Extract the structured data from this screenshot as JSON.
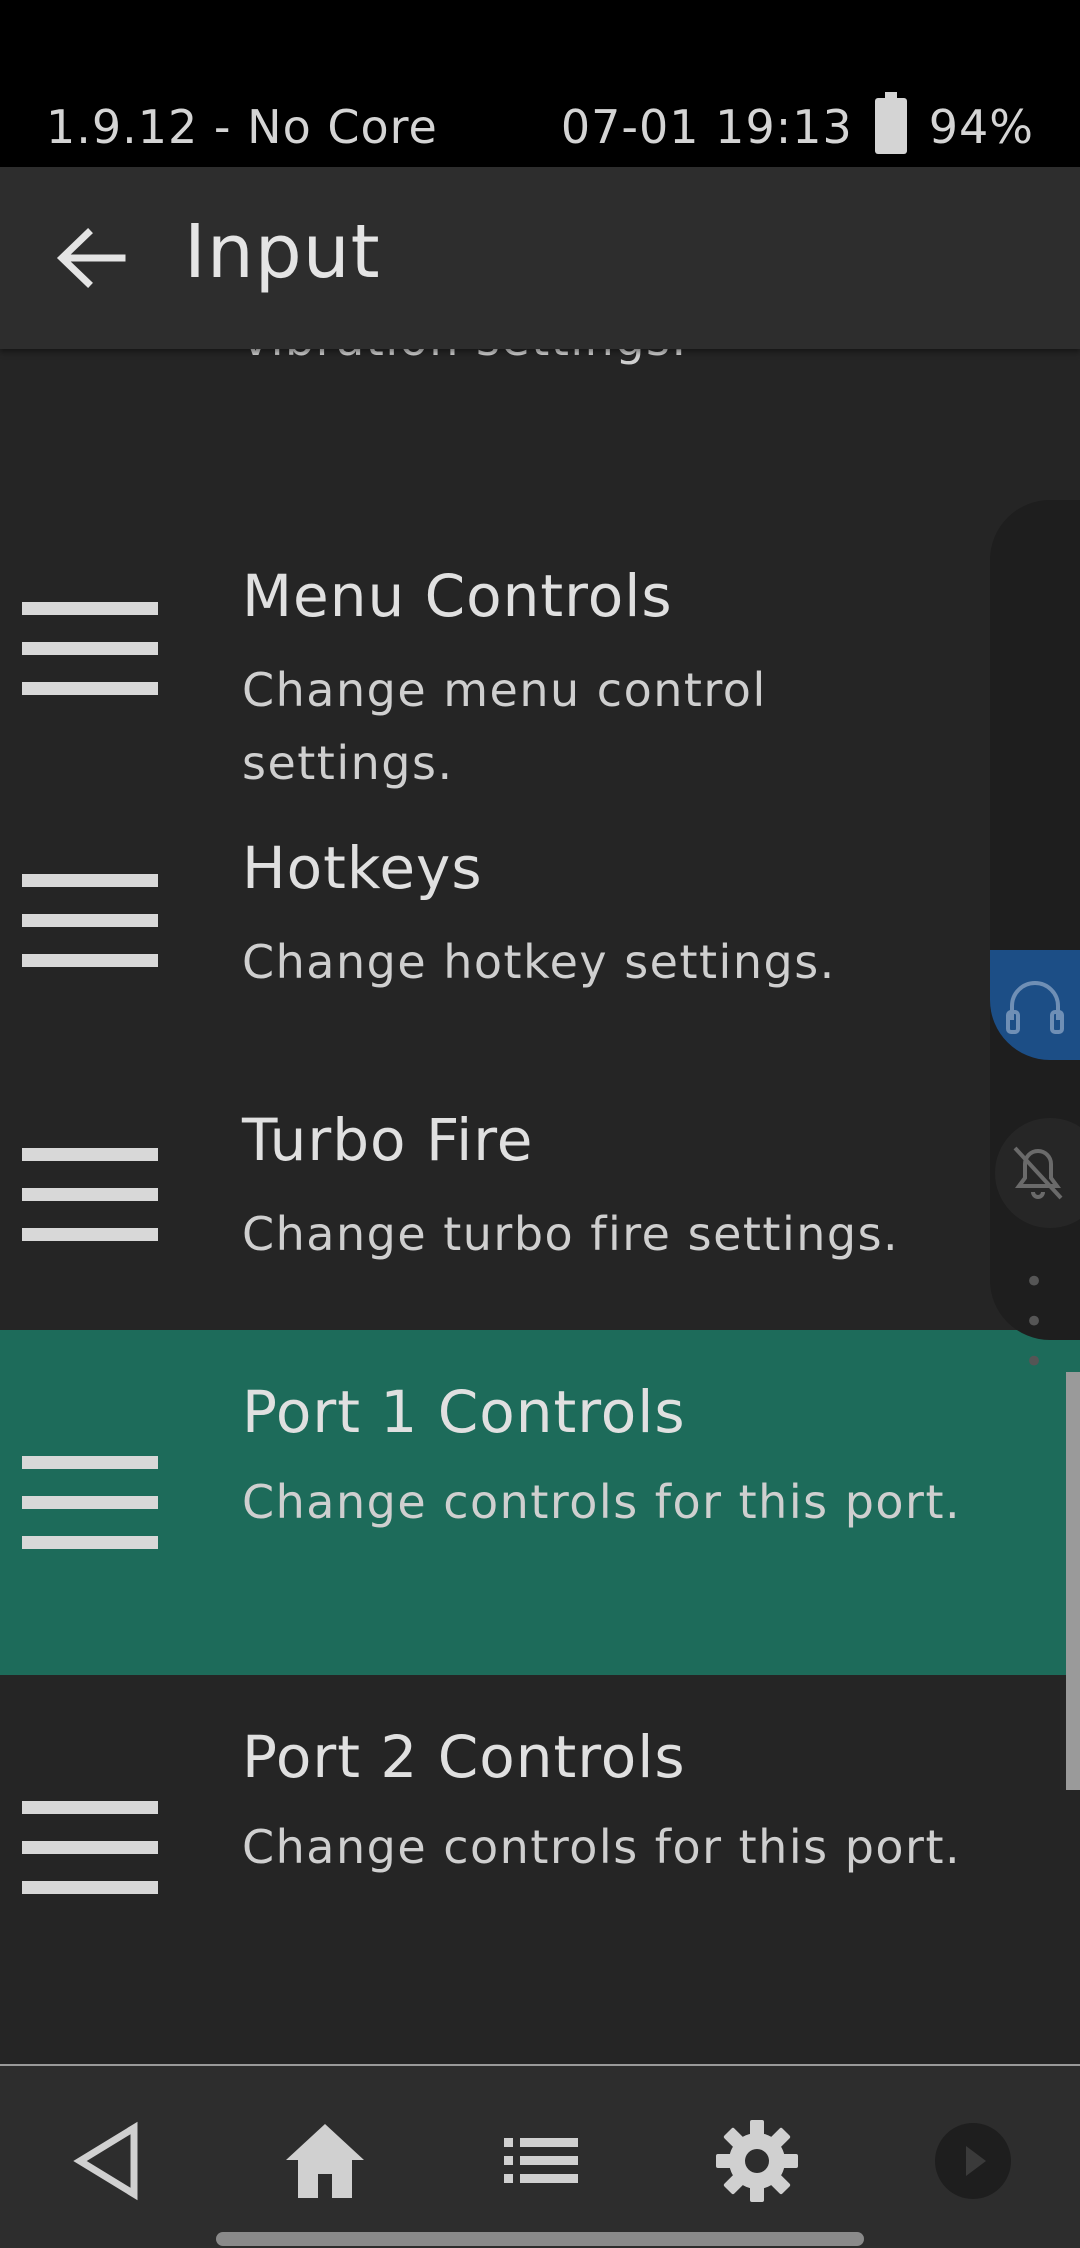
{
  "status_bar": {
    "left_text": "1.9.12 - No Core",
    "time": "07-01 19:13",
    "battery_icon": "battery-icon",
    "battery": "94%"
  },
  "header": {
    "back_icon": "arrow-left-icon",
    "title": "Input"
  },
  "items": [
    {
      "icon": "menu-lines-icon",
      "title": "",
      "subtitle": "Change haptic feedback and vibration settings."
    },
    {
      "icon": "menu-lines-icon",
      "title": "Menu Controls",
      "subtitle": "Change menu control settings."
    },
    {
      "icon": "menu-lines-icon",
      "title": "Hotkeys",
      "subtitle": "Change hotkey settings."
    },
    {
      "icon": "menu-lines-icon",
      "title": "Turbo Fire",
      "subtitle": "Change turbo fire settings."
    },
    {
      "icon": "menu-lines-icon",
      "title": "Port 1 Controls",
      "subtitle": "Change controls for this port.",
      "selected": true
    },
    {
      "icon": "menu-lines-icon",
      "title": "Port 2 Controls",
      "subtitle": "Change controls for this port."
    }
  ],
  "floating_panel": {
    "icons": [
      "headset-icon",
      "bell-off-icon",
      "more-dots-icon"
    ],
    "more_label": "• • •"
  },
  "nav_bar": {
    "buttons": [
      "back-triangle-icon",
      "home-icon",
      "list-icon",
      "settings-gear-icon",
      "play-icon"
    ]
  },
  "colors": {
    "background": "#252525",
    "header": "#2d2d2d",
    "selected": "#1d6b5a",
    "accent_blue": "#1c4e86"
  }
}
